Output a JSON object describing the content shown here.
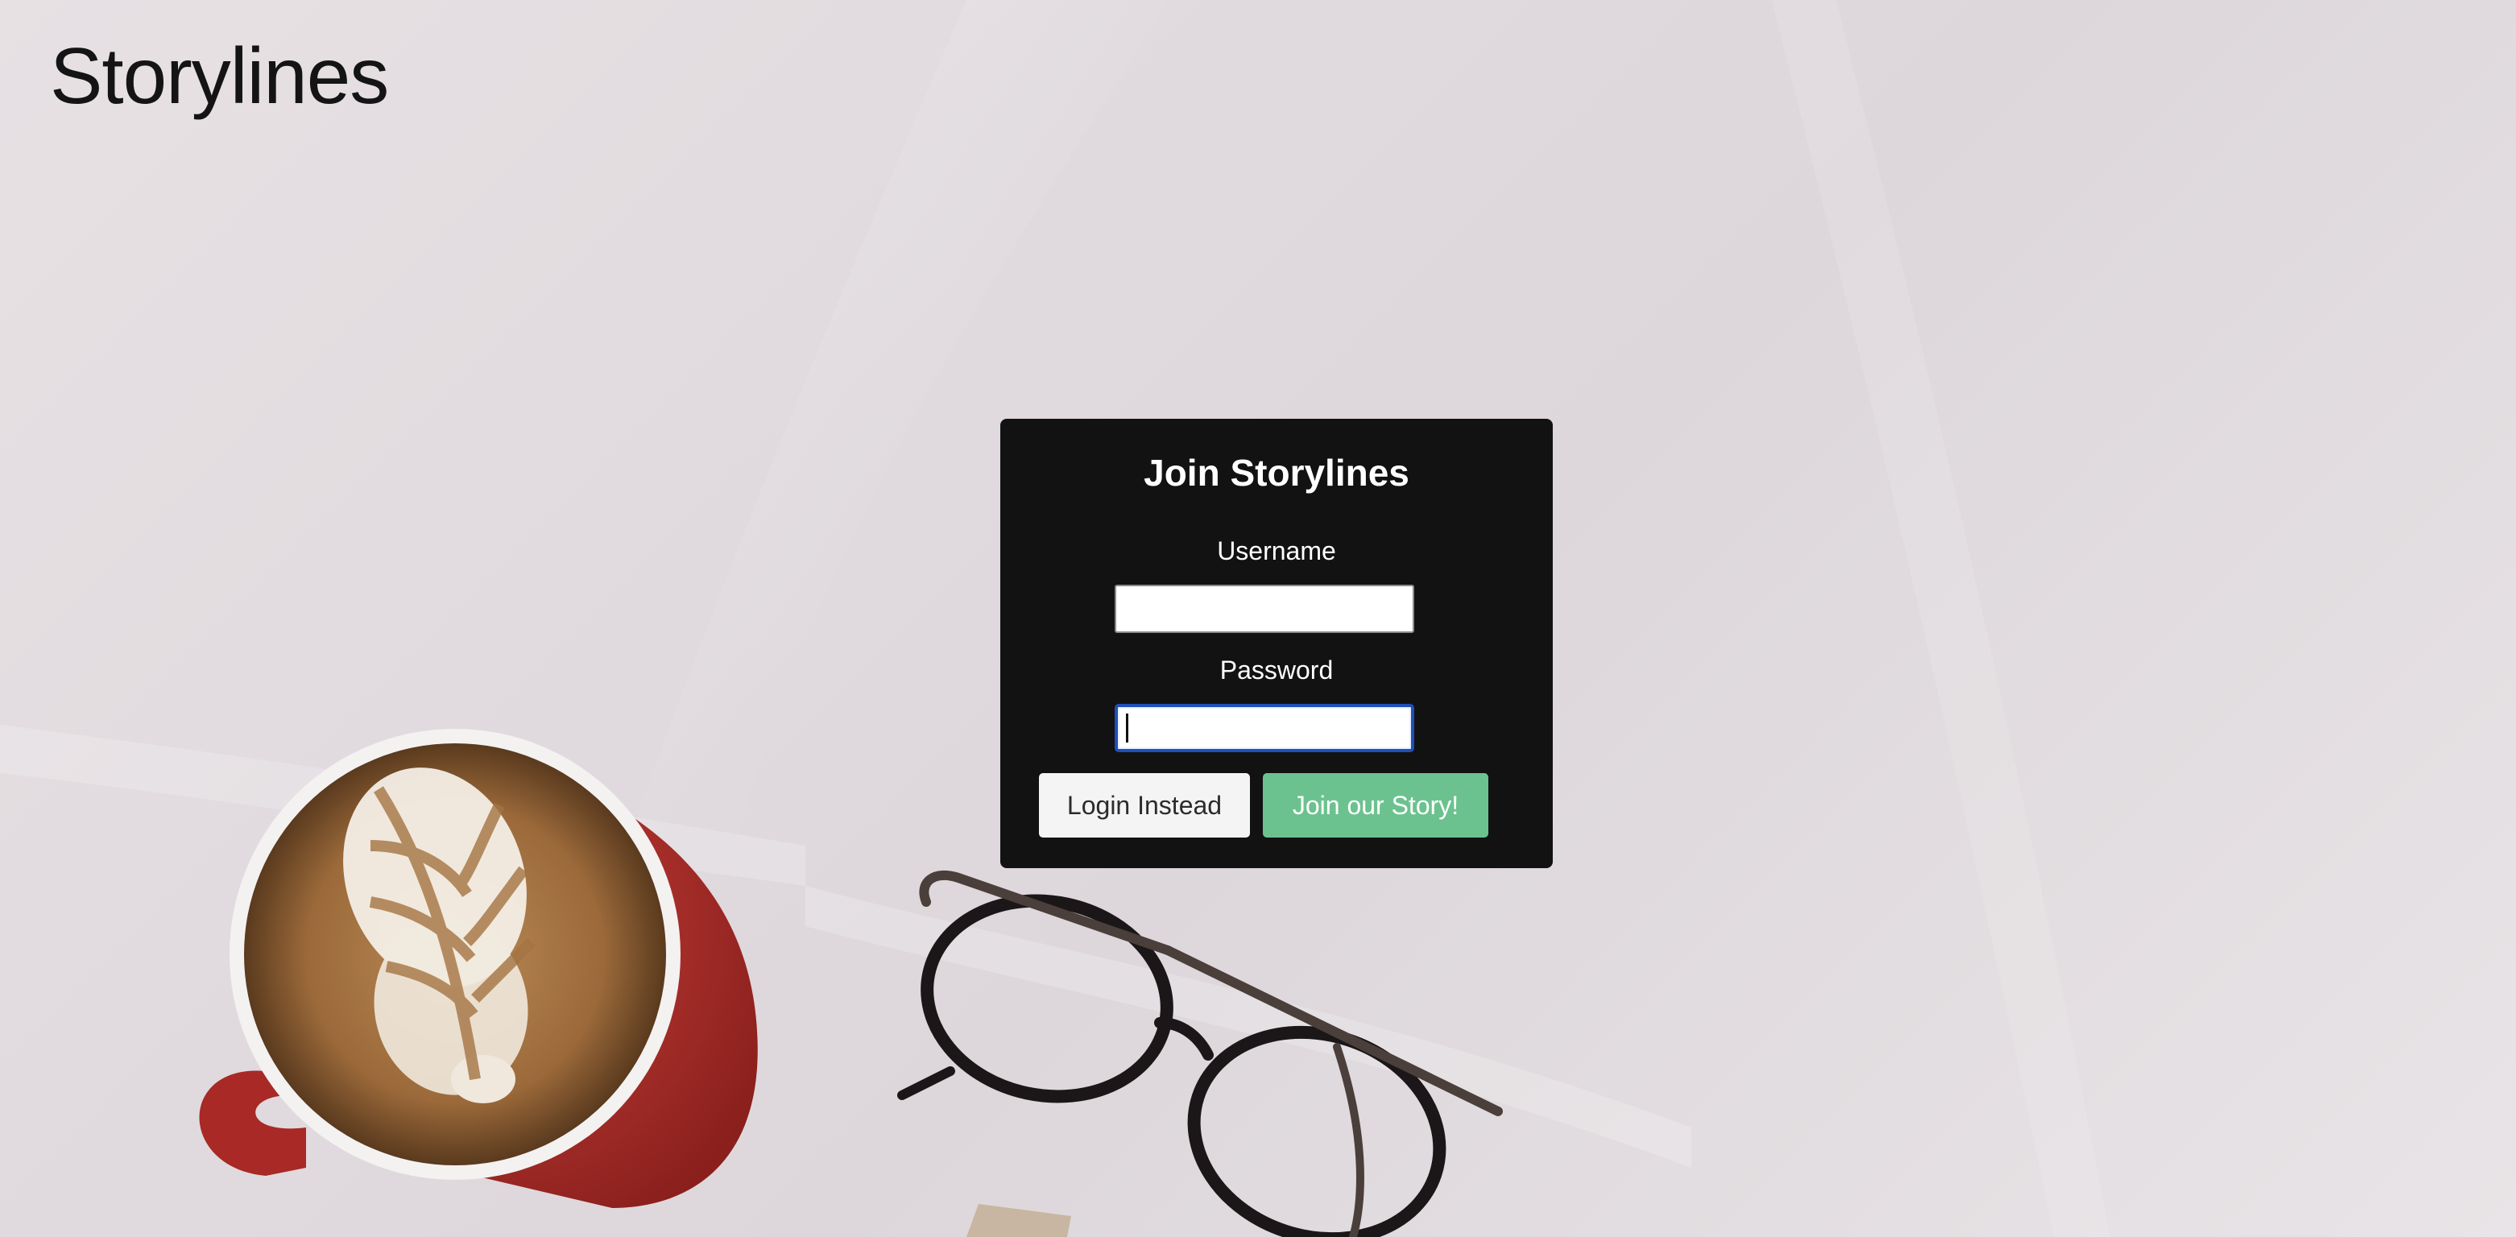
{
  "site": {
    "title": "Storylines"
  },
  "signup_form": {
    "heading": "Join Storylines",
    "username_label": "Username",
    "username_value": "",
    "password_label": "Password",
    "password_value": "",
    "login_button_label": "Login Instead",
    "join_button_label": "Join our Story!"
  },
  "colors": {
    "card_background": "#121212",
    "join_button": "#6cc28f",
    "login_button": "#f4f4f4",
    "focus_ring": "#1f4fb8"
  },
  "background_image": {
    "objects": [
      "coffee-mug",
      "eyeglasses",
      "white-fabric"
    ]
  }
}
